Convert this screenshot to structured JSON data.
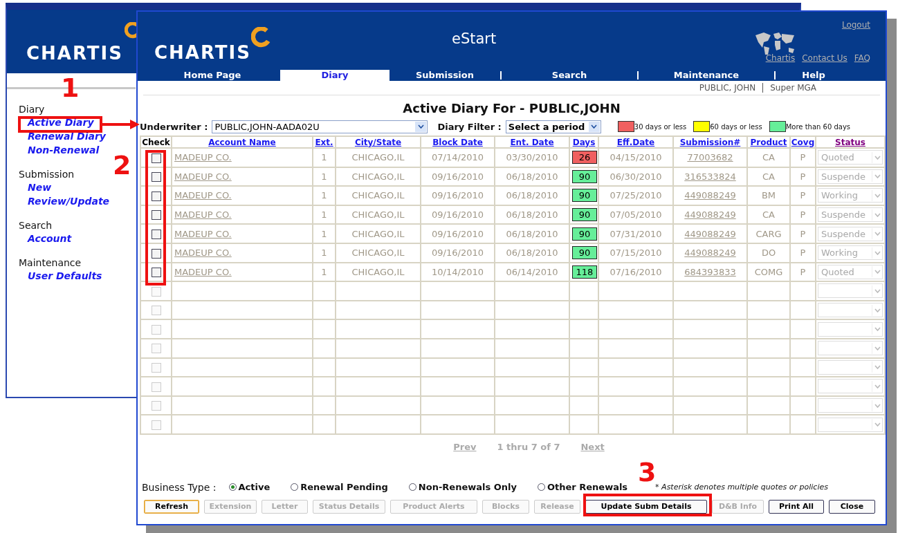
{
  "back_window": {
    "logo": "CHARTIS",
    "nav": [
      {
        "heading": "Diary",
        "links": [
          {
            "label": "Active Diary"
          },
          {
            "label": "Renewal Diary"
          },
          {
            "label": "Non-Renewal"
          }
        ]
      },
      {
        "heading": "Submission",
        "links": [
          {
            "label": "New"
          },
          {
            "label": "Review/Update"
          }
        ]
      },
      {
        "heading": "Search",
        "links": [
          {
            "label": "Account"
          }
        ]
      },
      {
        "heading": "Maintenance",
        "links": [
          {
            "label": "User Defaults"
          }
        ]
      }
    ]
  },
  "window": {
    "logo": "CHARTIS",
    "app_title": "eStart",
    "logout": "Logout",
    "header_links": [
      "Chartis",
      "Contact Us",
      "FAQ"
    ],
    "tabs": [
      {
        "label": "Home Page",
        "selected": false
      },
      {
        "label": "Diary",
        "selected": true
      },
      {
        "label": "Submission",
        "selected": false
      },
      {
        "label": "Search",
        "selected": false
      },
      {
        "label": "Maintenance",
        "selected": false
      },
      {
        "label": "Help",
        "selected": false
      }
    ],
    "user": "PUBLIC, JOHN",
    "role": "Super MGA",
    "page_title": "Active Diary For - PUBLIC,JOHN",
    "underwriter": {
      "label": "Underwriter :",
      "value": "PUBLIC,JOHN-AADA02U"
    },
    "diary_filter": {
      "label": "Diary Filter :",
      "value": "Select a period"
    },
    "legend": [
      {
        "label": "30 days or less",
        "color": "#f06060"
      },
      {
        "label": "60 days or less",
        "color": "#ffff00"
      },
      {
        "label": "More than 60 days",
        "color": "#66ee99"
      }
    ],
    "table": {
      "columns": [
        {
          "label": "Check",
          "kind": "plain"
        },
        {
          "label": "Account Name",
          "kind": "link"
        },
        {
          "label": "Ext.",
          "kind": "link"
        },
        {
          "label": "City/State",
          "kind": "link"
        },
        {
          "label": "Block Date",
          "kind": "link"
        },
        {
          "label": "Ent. Date",
          "kind": "link"
        },
        {
          "label": "Days",
          "kind": "link"
        },
        {
          "label": "Eff.Date",
          "kind": "link"
        },
        {
          "label": "Submission#",
          "kind": "link"
        },
        {
          "label": "Product",
          "kind": "link"
        },
        {
          "label": "Covg",
          "kind": "link"
        },
        {
          "label": "Status",
          "kind": "visited"
        }
      ],
      "rows": [
        {
          "checked": false,
          "disabled": false,
          "account": "MADEUP CO.",
          "ext": "1",
          "city_state": "CHICAGO,IL",
          "block_date": "07/14/2010",
          "ent_date": "03/30/2010",
          "days": "26",
          "color": "#f06060",
          "eff_date": "04/15/2010",
          "submission": "77003682",
          "product": "CA",
          "covg": "P",
          "status": "Quoted"
        },
        {
          "checked": false,
          "disabled": false,
          "account": "MADEUP CO.",
          "ext": "1",
          "city_state": "CHICAGO,IL",
          "block_date": "09/16/2010",
          "ent_date": "06/18/2010",
          "days": "90",
          "color": "#66ee99",
          "eff_date": "06/30/2010",
          "submission": "316533824",
          "product": "CA",
          "covg": "P",
          "status": "Suspende"
        },
        {
          "checked": false,
          "disabled": false,
          "account": "MADEUP CO.",
          "ext": "1",
          "city_state": "CHICAGO,IL",
          "block_date": "09/16/2010",
          "ent_date": "06/18/2010",
          "days": "90",
          "color": "#66ee99",
          "eff_date": "07/25/2010",
          "submission": "449088249",
          "product": "BM",
          "covg": "P",
          "status": "Working"
        },
        {
          "checked": false,
          "disabled": false,
          "account": "MADEUP CO.",
          "ext": "1",
          "city_state": "CHICAGO,IL",
          "block_date": "09/16/2010",
          "ent_date": "06/18/2010",
          "days": "90",
          "color": "#66ee99",
          "eff_date": "07/05/2010",
          "submission": "449088249",
          "product": "CA",
          "covg": "P",
          "status": "Suspende"
        },
        {
          "checked": false,
          "disabled": false,
          "account": "MADEUP CO.",
          "ext": "1",
          "city_state": "CHICAGO,IL",
          "block_date": "09/16/2010",
          "ent_date": "06/18/2010",
          "days": "90",
          "color": "#66ee99",
          "eff_date": "07/31/2010",
          "submission": "449088249",
          "product": "CARG",
          "covg": "P",
          "status": "Suspende"
        },
        {
          "checked": false,
          "disabled": false,
          "account": "MADEUP CO.",
          "ext": "1",
          "city_state": "CHICAGO,IL",
          "block_date": "09/16/2010",
          "ent_date": "06/18/2010",
          "days": "90",
          "color": "#66ee99",
          "eff_date": "07/15/2010",
          "submission": "449088249",
          "product": "DO",
          "covg": "P",
          "status": "Working"
        },
        {
          "checked": false,
          "disabled": false,
          "account": "MADEUP CO.",
          "ext": "1",
          "city_state": "CHICAGO,IL",
          "block_date": "10/14/2010",
          "ent_date": "06/14/2010",
          "days": "118",
          "color": "#66ee99",
          "eff_date": "07/16/2010",
          "submission": "684393833",
          "product": "COMG",
          "covg": "P",
          "status": "Quoted"
        },
        {
          "checked": false,
          "disabled": true
        },
        {
          "checked": false,
          "disabled": true
        },
        {
          "checked": false,
          "disabled": true
        },
        {
          "checked": false,
          "disabled": true
        },
        {
          "checked": false,
          "disabled": true
        },
        {
          "checked": false,
          "disabled": true
        },
        {
          "checked": false,
          "disabled": true
        },
        {
          "checked": false,
          "disabled": true
        }
      ]
    },
    "pagination": {
      "prev": "Prev",
      "range": "1 thru 7 of 7",
      "next": "Next"
    },
    "business_type": {
      "label": "Business Type :",
      "options": [
        {
          "label": "Active",
          "selected": true
        },
        {
          "label": "Renewal Pending",
          "selected": false
        },
        {
          "label": "Non-Renewals Only",
          "selected": false
        },
        {
          "label": "Other Renewals",
          "selected": false
        }
      ],
      "note": "* Asterisk denotes multiple quotes or policies"
    },
    "buttons": [
      {
        "label": "Refresh",
        "disabled": false,
        "focused": true
      },
      {
        "label": "Extension",
        "disabled": true,
        "focused": false
      },
      {
        "label": "Letter",
        "disabled": true,
        "focused": false
      },
      {
        "label": "Status Details",
        "disabled": true,
        "focused": false
      },
      {
        "label": "Product Alerts",
        "disabled": true,
        "focused": false
      },
      {
        "label": "Blocks",
        "disabled": true,
        "focused": false
      },
      {
        "label": "Release",
        "disabled": true,
        "focused": false
      },
      {
        "label": "Update Subm Details",
        "disabled": false,
        "focused": false
      },
      {
        "label": "D&B Info",
        "disabled": true,
        "focused": false
      },
      {
        "label": "Print All",
        "disabled": false,
        "focused": false
      },
      {
        "label": "Close",
        "disabled": false,
        "focused": false
      }
    ]
  },
  "annotations": [
    {
      "number": "1"
    },
    {
      "number": "2"
    },
    {
      "number": "3"
    }
  ]
}
